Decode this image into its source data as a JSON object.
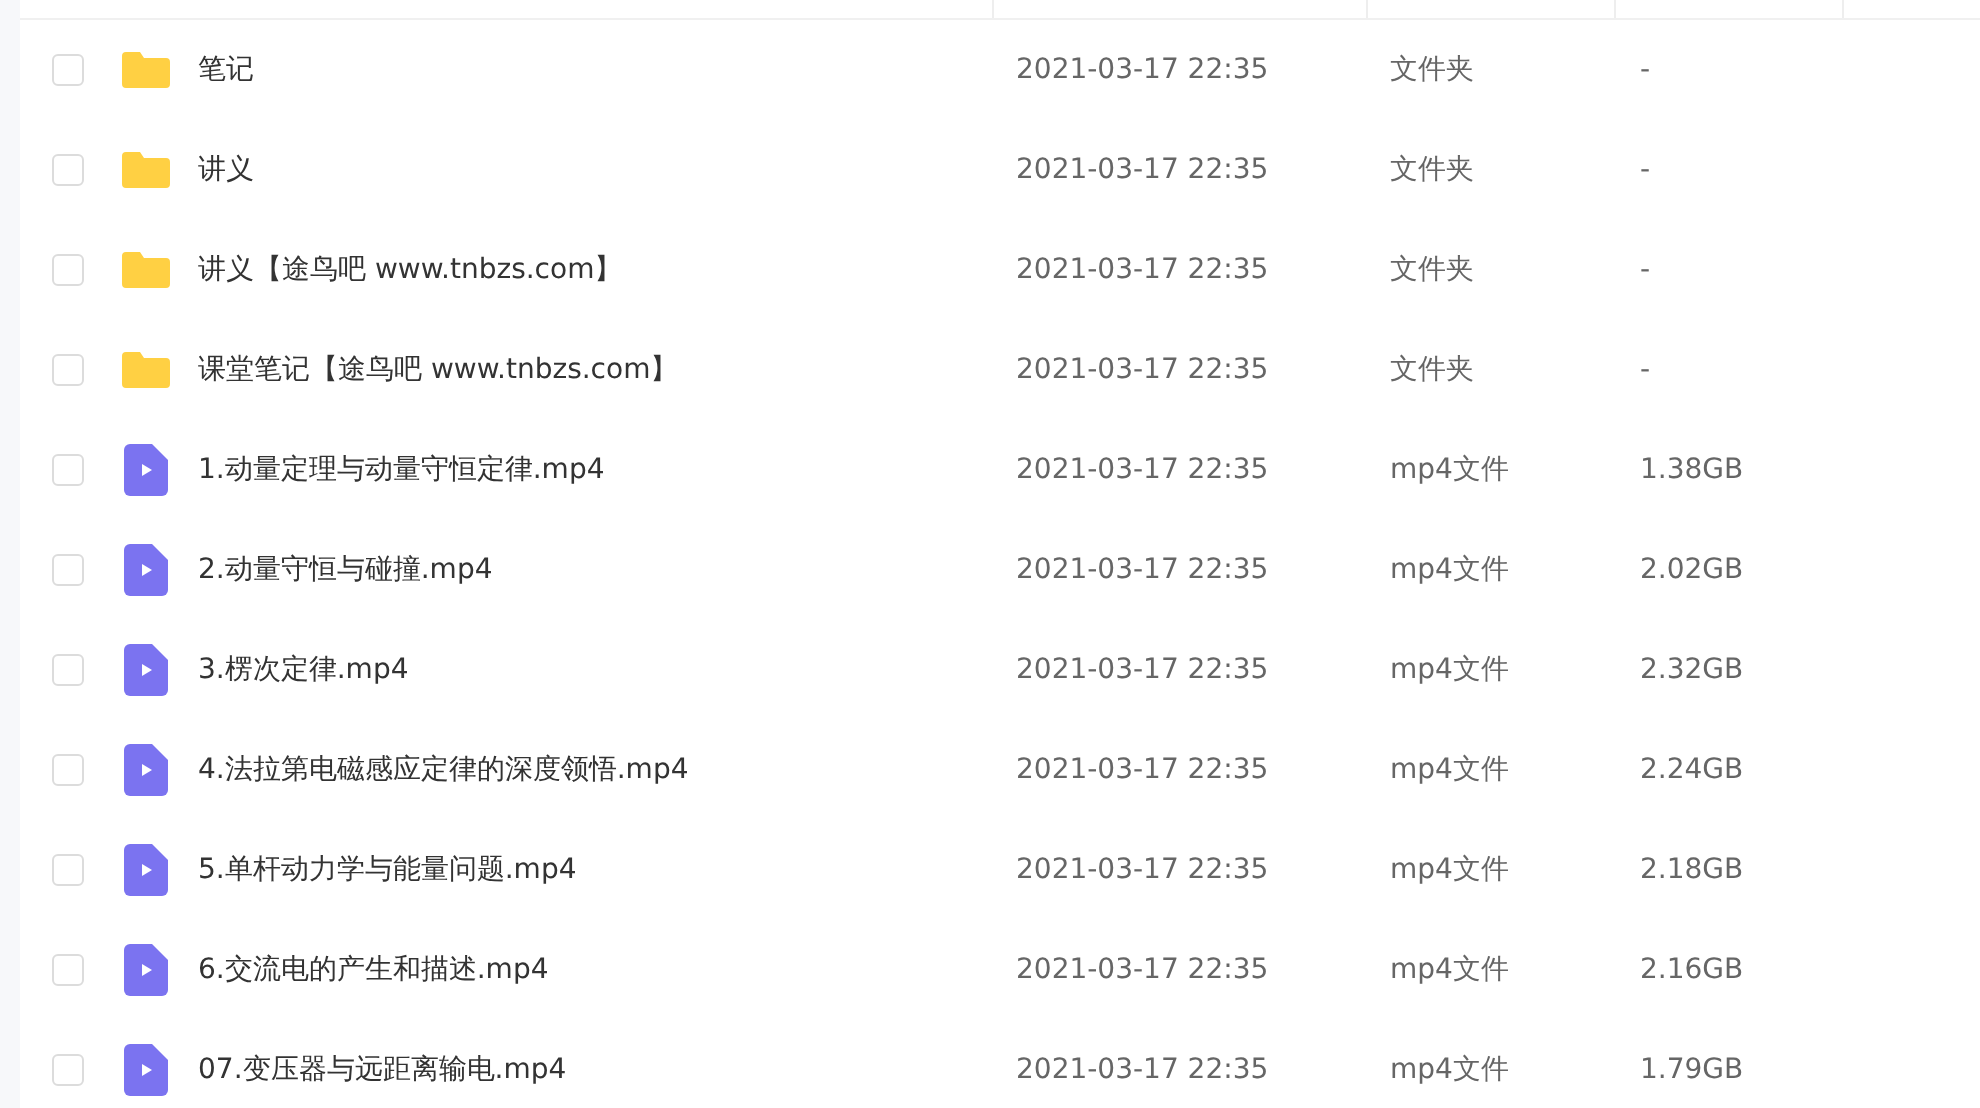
{
  "files": [
    {
      "kind": "folder",
      "name": "笔记",
      "modified": "2021-03-17 22:35",
      "type": "文件夹",
      "size": "-",
      "checked": false
    },
    {
      "kind": "folder",
      "name": "讲义",
      "modified": "2021-03-17 22:35",
      "type": "文件夹",
      "size": "-",
      "checked": false
    },
    {
      "kind": "folder",
      "name": "讲义【途鸟吧 www.tnbzs.com】",
      "modified": "2021-03-17 22:35",
      "type": "文件夹",
      "size": "-",
      "checked": false
    },
    {
      "kind": "folder",
      "name": "课堂笔记【途鸟吧 www.tnbzs.com】",
      "modified": "2021-03-17 22:35",
      "type": "文件夹",
      "size": "-",
      "checked": false
    },
    {
      "kind": "video",
      "name": "1.动量定理与动量守恒定律.mp4",
      "modified": "2021-03-17 22:35",
      "type": "mp4文件",
      "size": "1.38GB",
      "checked": false
    },
    {
      "kind": "video",
      "name": "2.动量守恒与碰撞.mp4",
      "modified": "2021-03-17 22:35",
      "type": "mp4文件",
      "size": "2.02GB",
      "checked": false
    },
    {
      "kind": "video",
      "name": "3.楞次定律.mp4",
      "modified": "2021-03-17 22:35",
      "type": "mp4文件",
      "size": "2.32GB",
      "checked": false
    },
    {
      "kind": "video",
      "name": "4.法拉第电磁感应定律的深度领悟.mp4",
      "modified": "2021-03-17 22:35",
      "type": "mp4文件",
      "size": "2.24GB",
      "checked": false
    },
    {
      "kind": "video",
      "name": "5.单杆动力学与能量问题.mp4",
      "modified": "2021-03-17 22:35",
      "type": "mp4文件",
      "size": "2.18GB",
      "checked": false
    },
    {
      "kind": "video",
      "name": "6.交流电的产生和描述.mp4",
      "modified": "2021-03-17 22:35",
      "type": "mp4文件",
      "size": "2.16GB",
      "checked": false
    },
    {
      "kind": "video",
      "name": "07.变压器与远距离输电.mp4",
      "modified": "2021-03-17 22:35",
      "type": "mp4文件",
      "size": "1.79GB",
      "checked": false
    }
  ]
}
